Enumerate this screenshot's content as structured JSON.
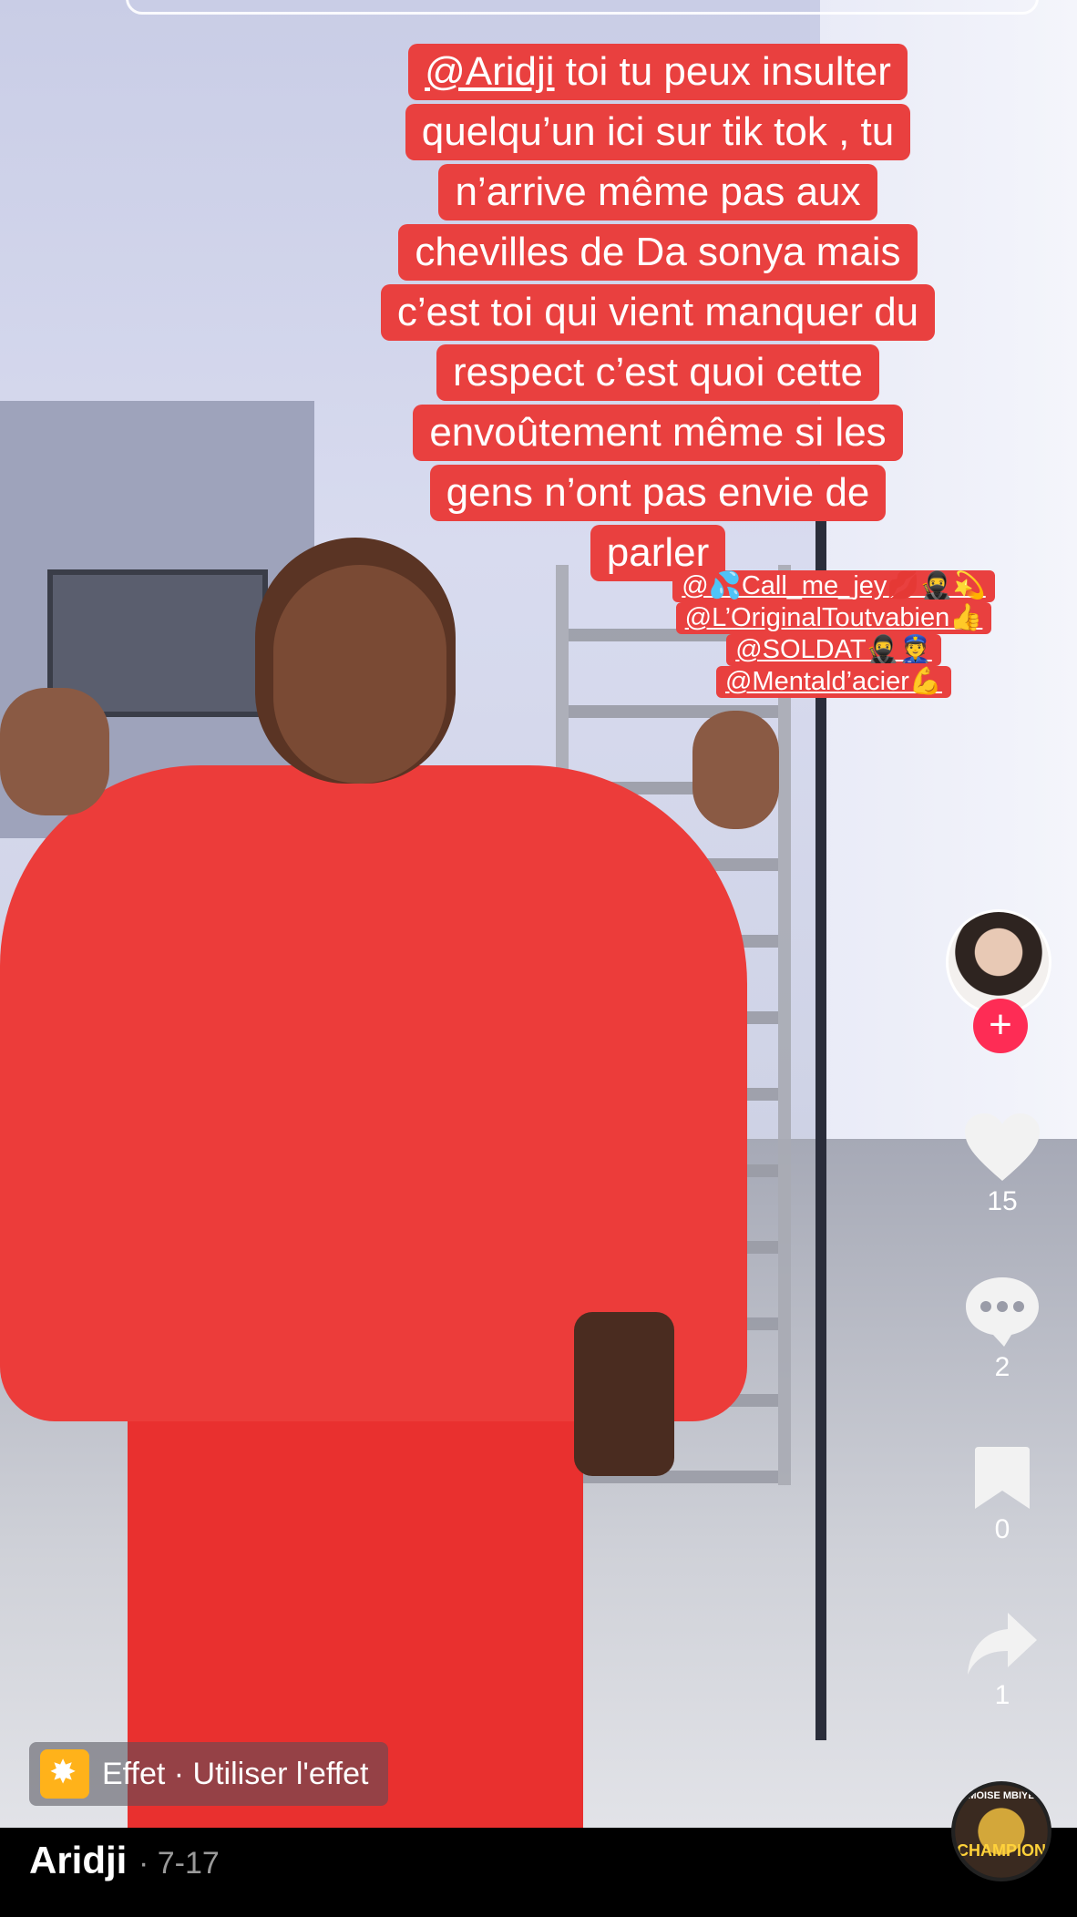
{
  "caption": {
    "mention": "@Aridji",
    "lines": [
      " toi tu peux insulter",
      "quelqu’un ici sur tik tok , tu",
      "n’arrive même pas aux",
      "chevilles de Da sonya mais",
      "c’est toi qui vient manquer du",
      "respect  c’est quoi cette",
      "envoûtement même si les",
      "gens n’ont pas envie de",
      "parler"
    ]
  },
  "tags": [
    "@💦Call_me_jey💋🥷💫",
    "@L’OriginalToutvabien👍",
    "@SOLDAT🥷👮",
    "@Mentald’acier💪"
  ],
  "actions": {
    "likes": "15",
    "comments": "2",
    "saves": "0",
    "shares": "1",
    "follow_label": "+"
  },
  "effect": {
    "label": "Effet · Utiliser l'effet"
  },
  "music_disc": {
    "line1": "MOISE MBIYE",
    "line2": "CHAMPION"
  },
  "author": {
    "name": "Aridji",
    "date": "· 7-17"
  },
  "colors": {
    "caption_bg": "#e9403f",
    "follow": "#fe2c55",
    "effect_icon": "#ffb21a"
  }
}
